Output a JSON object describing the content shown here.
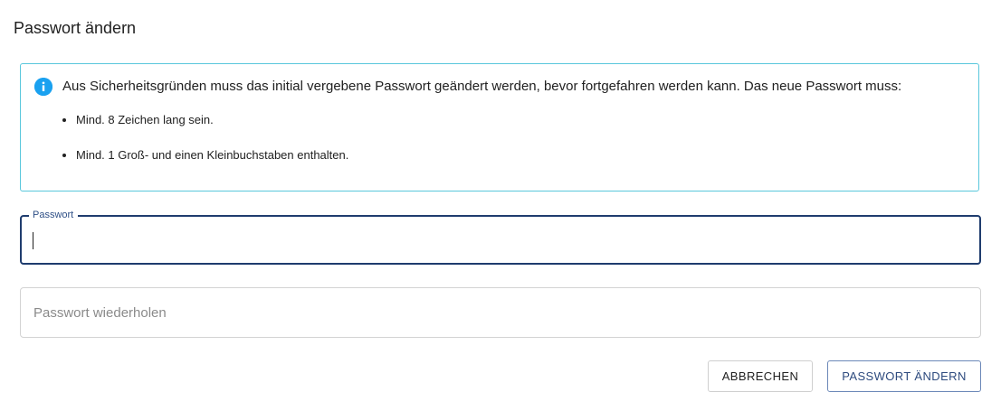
{
  "dialog": {
    "title": "Passwort ändern"
  },
  "info": {
    "icon": "info-icon",
    "color": "#1aa1f0",
    "text": "Aus Sicherheitsgründen muss das initial vergebene Passwort geändert werden, bevor fortgefahren werden kann. Das neue Passwort muss:",
    "rules": [
      "Mind. 8 Zeichen lang sein.",
      "Mind. 1 Groß- und einen Kleinbuchstaben enthalten."
    ]
  },
  "form": {
    "password": {
      "label": "Passwort",
      "value": ""
    },
    "password_repeat": {
      "placeholder": "Passwort wiederholen",
      "value": ""
    }
  },
  "actions": {
    "cancel_label": "Abbrechen",
    "submit_label": "Passwort ändern"
  },
  "colors": {
    "focus_border": "#1f3c6e",
    "info_border": "#59c7dc",
    "primary_text": "#2d4a7e"
  }
}
